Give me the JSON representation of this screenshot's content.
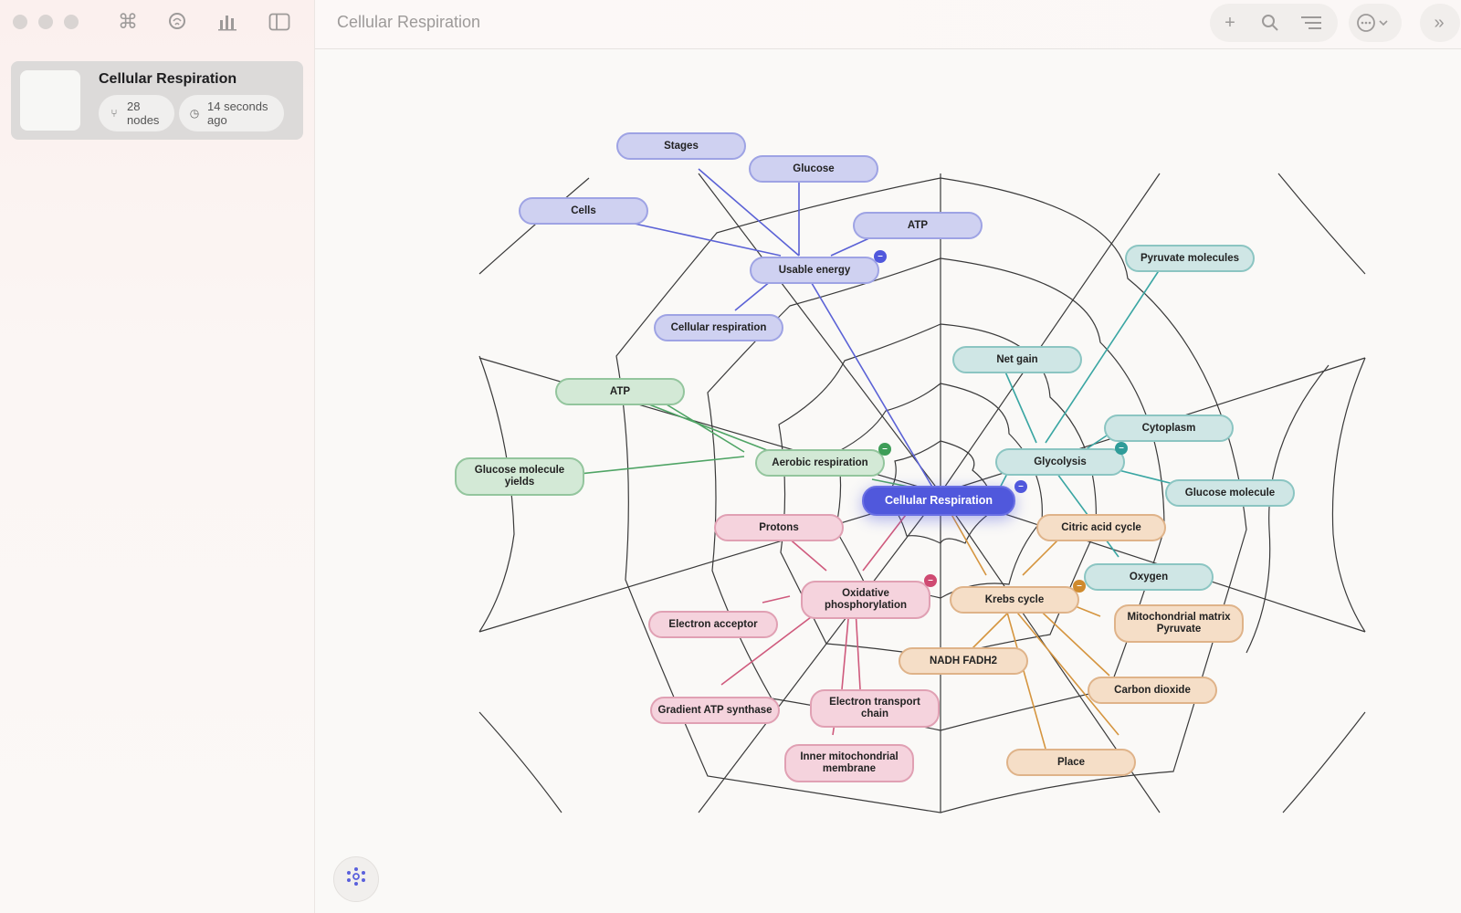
{
  "window": {
    "title": "Cellular Respiration"
  },
  "sidebar": {
    "card": {
      "title": "Cellular Respiration",
      "nodes_count": "28",
      "nodes_label": "nodes",
      "updated_value": "14 seconds",
      "updated_suffix": "ago"
    }
  },
  "toolbar": {
    "icons": [
      "command-icon",
      "brain-icon",
      "chart-icon",
      "sidebar-toggle-icon",
      "plus-icon",
      "search-icon",
      "outline-icon",
      "more-icon",
      "expand-icon"
    ]
  },
  "colors": {
    "blue": "#5b62d6",
    "green": "#4fa465",
    "teal": "#3aa6a3",
    "pink": "#cf5a7d",
    "orange": "#d5953f",
    "web": "#333333"
  },
  "map": {
    "root": "Cellular Respiration",
    "nodes": {
      "stages": "Stages",
      "glucose": "Glucose",
      "cells": "Cells",
      "atp_top": "ATP",
      "usable_energy": "Usable energy",
      "cellular_respiration": "Cellular respiration",
      "pyruvate_molecules": "Pyruvate molecules",
      "net_gain": "Net gain",
      "atp_left": "ATP",
      "cytoplasm": "Cytoplasm",
      "aerobic_respiration": "Aerobic respiration",
      "glycolysis": "Glycolysis",
      "glucose_molecule_yields": "Glucose molecule yields",
      "glucose_molecule": "Glucose molecule",
      "protons": "Protons",
      "citric_acid_cycle": "Citric acid cycle",
      "oxygen": "Oxygen",
      "oxidative_phosphorylation": "Oxidative phosphorylation",
      "krebs_cycle": "Krebs cycle",
      "electron_acceptor": "Electron acceptor",
      "mitochondrial_matrix": "Mitochondrial matrix Pyruvate",
      "nadh_fadh2": "NADH FADH2",
      "carbon_dioxide": "Carbon dioxide",
      "gradient_atp": "Gradient ATP synthase",
      "etc": "Electron transport chain",
      "inner_membrane": "Inner mitochondrial membrane",
      "place": "Place"
    }
  }
}
